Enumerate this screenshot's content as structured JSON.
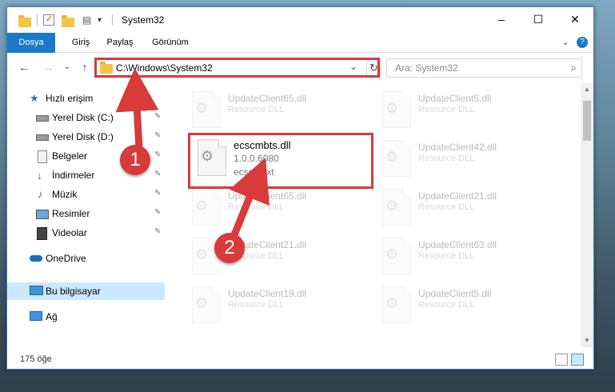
{
  "window": {
    "title": "System32",
    "minimize": "–",
    "maximize": "☐",
    "close": "✕"
  },
  "ribbon": {
    "tabs": [
      "Dosya",
      "Giriş",
      "Paylaş",
      "Görünüm"
    ],
    "expand": "⌄",
    "help": "?"
  },
  "address": {
    "path": "C:\\Windows\\System32",
    "dropdown": "⌄",
    "refresh": "↻"
  },
  "search": {
    "placeholder": "Ara: System32",
    "icon": "⌕"
  },
  "nav_buttons": {
    "back": "←",
    "forward": "→",
    "recent": "⌄",
    "up": "↑"
  },
  "sidebar": {
    "items": [
      {
        "label": "Hızlı erişim",
        "icon": "star-icon",
        "pinned": false
      },
      {
        "label": "Yerel Disk (C:)",
        "icon": "drive-icon",
        "pinned": true
      },
      {
        "label": "Yerel Disk (D:)",
        "icon": "drive-icon",
        "pinned": true
      },
      {
        "label": "Belgeler",
        "icon": "documents-icon",
        "pinned": true
      },
      {
        "label": "İndirmeler",
        "icon": "download-icon",
        "pinned": true
      },
      {
        "label": "Müzik",
        "icon": "music-icon",
        "pinned": true
      },
      {
        "label": "Resimler",
        "icon": "pictures-icon",
        "pinned": true
      },
      {
        "label": "Videolar",
        "icon": "video-icon",
        "pinned": true
      },
      {
        "label": "OneDrive",
        "icon": "cloud-icon",
        "pinned": false
      },
      {
        "label": "Bu bilgisayar",
        "icon": "computer-icon",
        "pinned": false,
        "selected": true
      },
      {
        "label": "Ağ",
        "icon": "network-icon",
        "pinned": false
      }
    ],
    "pin_glyph": "📌"
  },
  "files": {
    "highlighted": {
      "name": "ecscmbts.dll",
      "version": "1.0.0.6080",
      "description": "ecscmext"
    },
    "background": [
      {
        "name": "UpdateClient65.dll",
        "type": "Resource DLL"
      },
      {
        "name": "UpdateClient5.dll",
        "type": "Resource DLL"
      },
      {
        "name": "UpdateClient42.dll",
        "type": "Resource DLL"
      },
      {
        "name": "UpdateClient65.dll",
        "type": "Resource DLL"
      },
      {
        "name": "UpdateClient21.dll",
        "type": "Resource DLL"
      },
      {
        "name": "UpdateClient21.dll",
        "type": "Resource DLL"
      },
      {
        "name": "UpdateClient63.dll",
        "type": "Resource DLL"
      },
      {
        "name": "UpdateClient19.dll",
        "type": "Resource DLL"
      },
      {
        "name": "UpdateClient5.dll",
        "type": "Resource DLL"
      }
    ]
  },
  "status": {
    "count": "175 öğe"
  },
  "annotations": {
    "step1": "1",
    "step2": "2",
    "color": "#d93a3a"
  }
}
